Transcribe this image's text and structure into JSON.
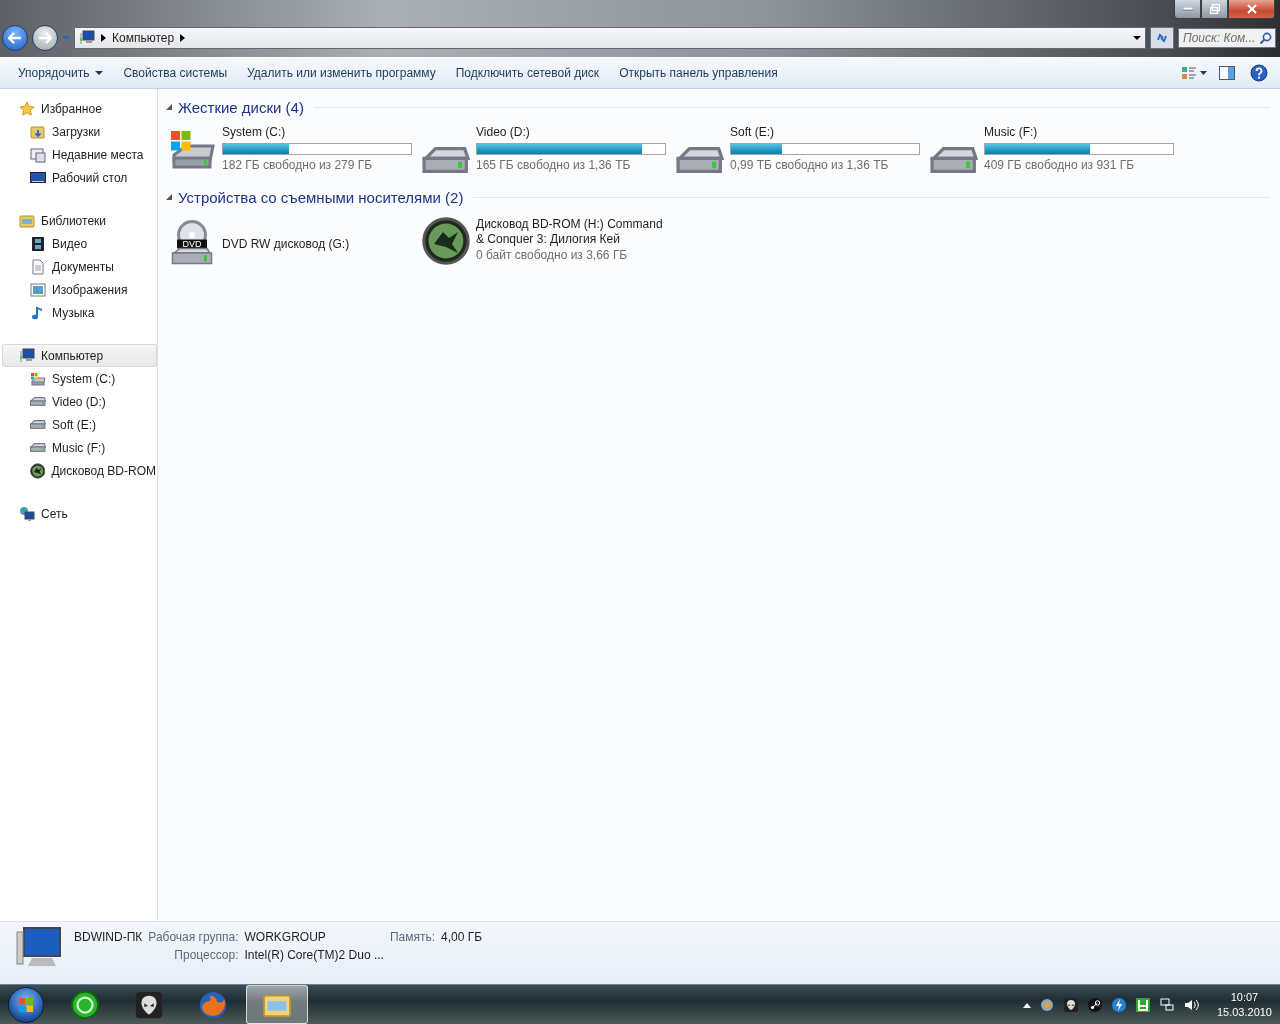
{
  "address": {
    "crumbs": [
      "Компьютер"
    ],
    "search": {
      "placeholder": "Поиск: Ком..."
    }
  },
  "toolbar": {
    "items": [
      {
        "label": "Упорядочить",
        "dropdown": true
      },
      {
        "label": "Свойства системы",
        "dropdown": false
      },
      {
        "label": "Удалить или изменить программу",
        "dropdown": false
      },
      {
        "label": "Подключить сетевой диск",
        "dropdown": false
      },
      {
        "label": "Открыть панель управления",
        "dropdown": false
      }
    ]
  },
  "sidebar": {
    "groups": [
      {
        "label": "Избранное",
        "selected": false,
        "items": [
          {
            "label": "Загрузки",
            "selected": false
          },
          {
            "label": "Недавние места",
            "selected": false
          },
          {
            "label": "Рабочий стол",
            "selected": false
          }
        ]
      },
      {
        "label": "Библиотеки",
        "selected": false,
        "items": [
          {
            "label": "Видео",
            "selected": false
          },
          {
            "label": "Документы",
            "selected": false
          },
          {
            "label": "Изображения",
            "selected": false
          },
          {
            "label": "Музыка",
            "selected": false
          }
        ]
      },
      {
        "label": "Компьютер",
        "selected": true,
        "items": [
          {
            "label": "System (C:)",
            "selected": false
          },
          {
            "label": "Video (D:)",
            "selected": false
          },
          {
            "label": "Soft (E:)",
            "selected": false
          },
          {
            "label": "Music (F:)",
            "selected": false
          },
          {
            "label": "Дисковод BD-ROM",
            "selected": false
          }
        ]
      },
      {
        "label": "Сеть",
        "selected": false
      }
    ]
  },
  "groups": [
    {
      "title": "Жесткие диски (4)",
      "items": [
        {
          "kind": "system",
          "name": "System (C:)",
          "level": 0.35,
          "free": "182 ГБ свободно из 279 ГБ"
        },
        {
          "kind": "drive",
          "name": "Video (D:)",
          "level": 0.88,
          "free": "165 ГБ свободно из 1,36 ТБ"
        },
        {
          "kind": "drive",
          "name": "Soft (E:)",
          "level": 0.27,
          "free": "0,99 ТБ свободно из 1,36 ТБ"
        },
        {
          "kind": "drive",
          "name": "Music (F:)",
          "level": 0.56,
          "free": "409 ГБ свободно из 931 ГБ"
        }
      ]
    },
    {
      "title": "Устройства со съемными носителями (2)",
      "items": [
        {
          "kind": "dvd",
          "name": "DVD RW дисковод (G:)",
          "icon_label": "DVD"
        },
        {
          "kind": "disc",
          "name": "Дисковод BD-ROM (H:) Command & Conquer 3: Дилогия Кей",
          "free": "0 байт свободно из 3,66 ГБ"
        }
      ]
    }
  ],
  "details": {
    "name": "BDWIND-ПК",
    "fields": [
      {
        "label": "Рабочая группа:",
        "value": "WORKGROUP"
      },
      {
        "label": "Память:",
        "value": "4,00 ГБ"
      },
      {
        "label": "Процессор:",
        "value": "Intel(R) Core(TM)2 Duo ..."
      }
    ]
  },
  "taskbar": {
    "apps": [
      {
        "selected": false
      },
      {
        "selected": false
      },
      {
        "selected": false
      },
      {
        "selected": true
      }
    ],
    "time": "10:07",
    "date": "15.03.2010"
  }
}
